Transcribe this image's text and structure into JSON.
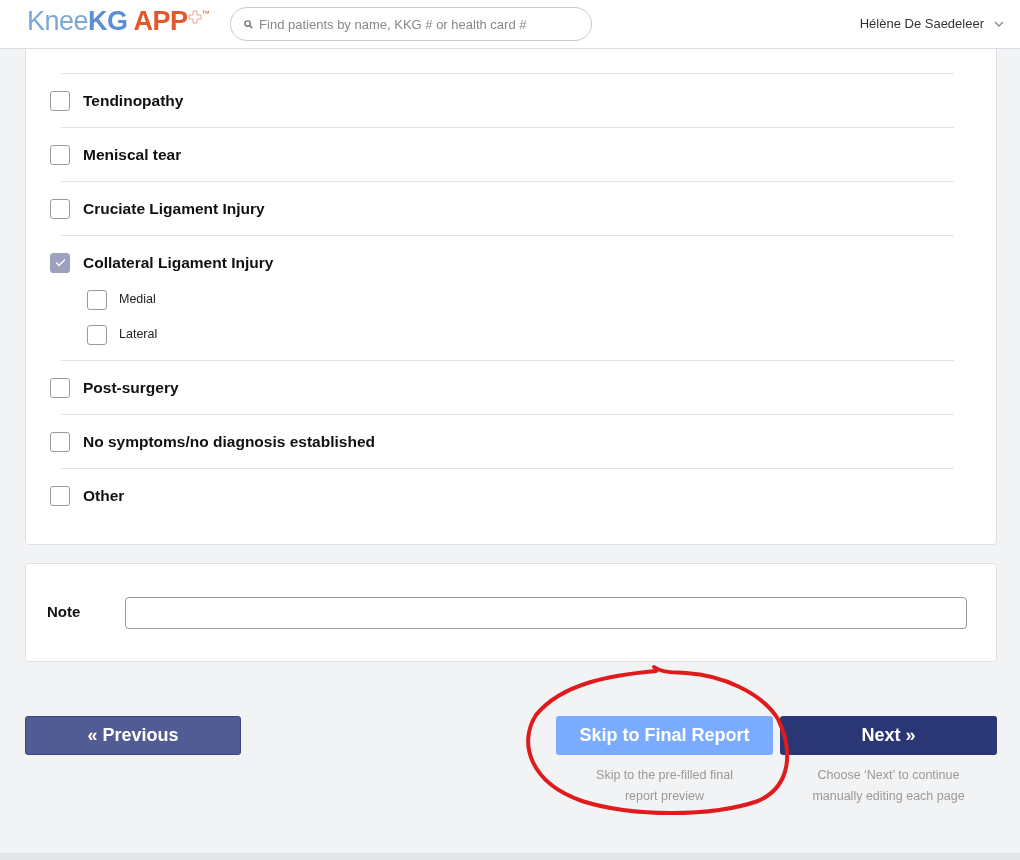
{
  "header": {
    "logo": [
      {
        "kind": "light",
        "text": "Knee"
      },
      {
        "kind": "strong",
        "text": "KG"
      },
      {
        "kind": "accent",
        "text": "APP"
      },
      {
        "kind": "mark",
        "text": "™"
      }
    ],
    "search": {
      "placeholder": "Find patients by name, KKG # or health card #"
    },
    "user": {
      "name": "Hélène De Saedeleer"
    }
  },
  "conditions": [
    {
      "label": "Tendinopathy",
      "checked": false
    },
    {
      "label": "Meniscal tear",
      "checked": false
    },
    {
      "label": "Cruciate Ligament Injury",
      "checked": false
    },
    {
      "label": "Collateral Ligament Injury",
      "checked": true,
      "options": [
        {
          "label": "Medial",
          "checked": false
        },
        {
          "label": "Lateral",
          "checked": false
        }
      ]
    },
    {
      "label": "Post-surgery",
      "checked": false
    },
    {
      "label": "No symptoms/no diagnosis established",
      "checked": false
    },
    {
      "label": "Other",
      "checked": false
    }
  ],
  "note": {
    "label": "Note"
  },
  "navigation": {
    "previous": {
      "label": "« Previous"
    },
    "skip": {
      "label": "Skip to Final Report",
      "caption": "Skip to the pre-filled final report preview"
    },
    "next": {
      "label": "Next »",
      "caption": "Choose ‘Next’ to continue manually editing each page"
    }
  }
}
